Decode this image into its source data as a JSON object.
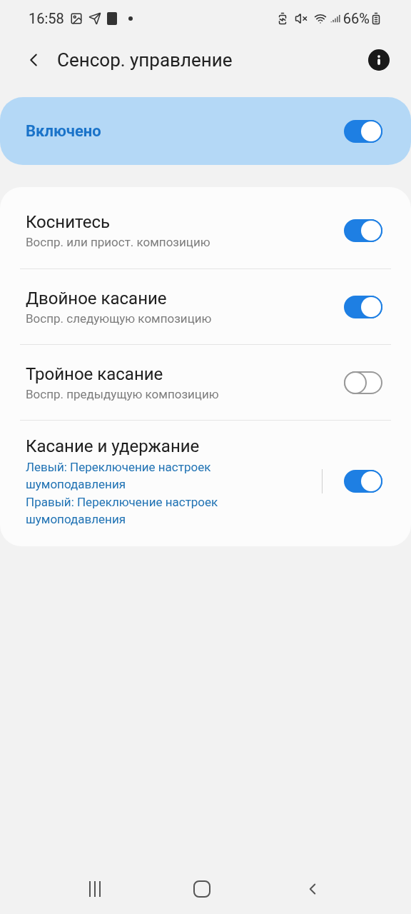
{
  "status_bar": {
    "time": "16:58",
    "battery": "66%"
  },
  "header": {
    "title": "Сенсор. управление"
  },
  "master": {
    "label": "Включено",
    "on": true
  },
  "settings": [
    {
      "kind": "plain",
      "title": "Коснитесь",
      "lines": [
        "Воспр. или приост. композицию"
      ],
      "on": true
    },
    {
      "kind": "plain",
      "title": "Двойное касание",
      "lines": [
        "Воспр. следующую композицию"
      ],
      "on": true
    },
    {
      "kind": "plain",
      "title": "Тройное касание",
      "lines": [
        "Воспр. предыдущую композицию"
      ],
      "on": false
    },
    {
      "kind": "detail",
      "title": "Касание и удержание",
      "lines": [
        "Левый: Переключение настроек шумоподавления",
        "Правый: Переключение настроек шумоподавления"
      ],
      "on": true
    }
  ]
}
